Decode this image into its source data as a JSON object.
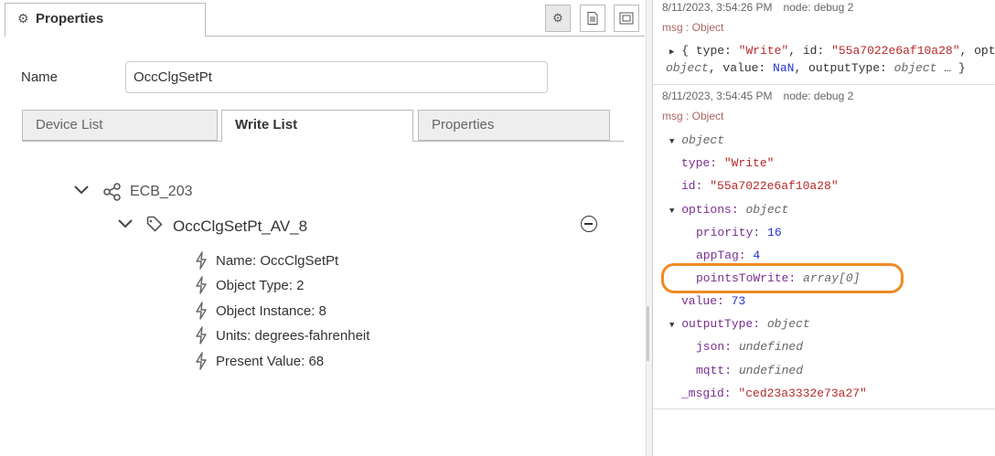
{
  "properties_panel": {
    "tab_title": "Properties",
    "name_label": "Name",
    "name_value": "OccClgSetPt",
    "subtabs": [
      {
        "label": "Device List"
      },
      {
        "label": "Write List"
      },
      {
        "label": "Properties"
      }
    ],
    "tree": {
      "device": "ECB_203",
      "object": "OccClgSetPt_AV_8",
      "props": [
        "Name: OccClgSetPt",
        "Object Type: 2",
        "Object Instance: 8",
        "Units: degrees-fahrenheit",
        "Present Value: 68"
      ]
    }
  },
  "debug_panel": {
    "msg1": {
      "timestamp": "8/11/2023, 3:54:26 PM",
      "node": "node: debug 2",
      "topic": "msg : Object",
      "line1_prefix": "{ type: ",
      "line1_type": "\"Write\"",
      "line1_mid": ", id: ",
      "line1_id": "\"55a7022e6af10a28\"",
      "line1_suffix": ", opt",
      "line2_a": "object",
      "line2_b": ", value: ",
      "line2_nan": "NaN",
      "line2_c": ", outputType: ",
      "line2_d": "object",
      "line2_e": " … }"
    },
    "msg2": {
      "timestamp": "8/11/2023, 3:54:45 PM",
      "node": "node: debug 2",
      "topic": "msg : Object",
      "root": "object",
      "type_key": "type:",
      "type_val": "\"Write\"",
      "id_key": "id:",
      "id_val": "\"55a7022e6af10a28\"",
      "options_key": "options:",
      "options_val": "object",
      "priority_key": "priority:",
      "priority_val": "16",
      "apptag_key": "appTag:",
      "apptag_val": "4",
      "points_key": "pointsToWrite:",
      "points_val": "array[0]",
      "value_key": "value:",
      "value_val": "73",
      "outtype_key": "outputType:",
      "outtype_val": "object",
      "json_key": "json:",
      "json_val": "undefined",
      "mqtt_key": "mqtt:",
      "mqtt_val": "undefined",
      "msgid_key": "_msgid:",
      "msgid_val": "\"ced23a3332e73a27\""
    }
  },
  "colors": {
    "highlight": "#f08a24",
    "key": "#792e90",
    "string": "#b72828",
    "number": "#2033d6"
  }
}
